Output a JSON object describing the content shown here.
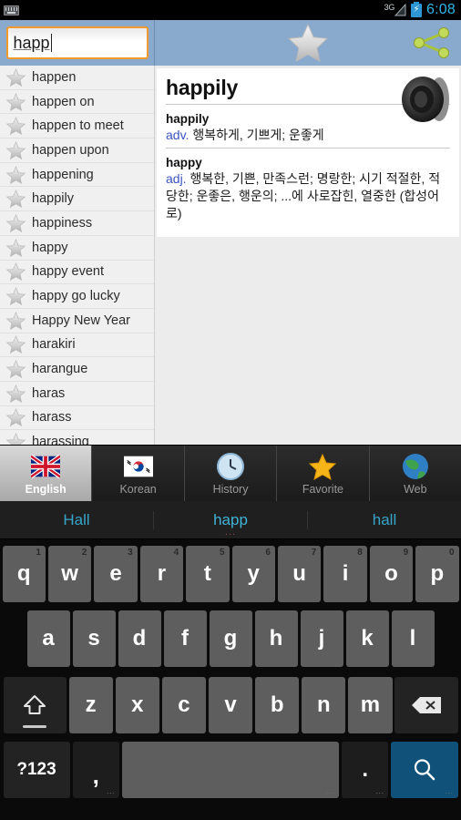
{
  "statusbar": {
    "keyboard_icon": "keyboard-icon",
    "network_label": "3G",
    "battery_icon": "battery-charging-icon",
    "time": "6:08"
  },
  "topbar": {
    "search_value": "happ",
    "search_placeholder": "",
    "favorite_icon": "star-icon",
    "share_icon": "share-icon"
  },
  "wordlist": {
    "items": [
      {
        "label": "happen"
      },
      {
        "label": "happen on"
      },
      {
        "label": "happen to meet"
      },
      {
        "label": "happen upon"
      },
      {
        "label": "happening"
      },
      {
        "label": "happily"
      },
      {
        "label": "happiness"
      },
      {
        "label": "happy"
      },
      {
        "label": "happy event"
      },
      {
        "label": "happy go lucky"
      },
      {
        "label": "Happy New Year"
      },
      {
        "label": "harakiri"
      },
      {
        "label": "harangue"
      },
      {
        "label": "haras"
      },
      {
        "label": "harass"
      },
      {
        "label": "harassing"
      }
    ]
  },
  "definition": {
    "headword": "happily",
    "speaker_icon": "speaker-icon",
    "entries": [
      {
        "word": "happily",
        "pos": "adv.",
        "meaning": "행복하게, 기쁘게; 운좋게"
      },
      {
        "word": "happy",
        "pos": "adj.",
        "meaning": "행복한, 기쁜, 만족스런; 명랑한; 시기 적절한, 적당한; 운좋은, 행운의; ...에 사로잡힌, 열중한 (합성어로)"
      }
    ]
  },
  "tabs": [
    {
      "label": "English",
      "icon": "uk-flag-icon",
      "active": true
    },
    {
      "label": "Korean",
      "icon": "korea-flag-icon",
      "active": false
    },
    {
      "label": "History",
      "icon": "clock-icon",
      "active": false
    },
    {
      "label": "Favorite",
      "icon": "star-icon",
      "active": false
    },
    {
      "label": "Web",
      "icon": "globe-icon",
      "active": false
    }
  ],
  "keyboard": {
    "suggestions": [
      {
        "text": "Hall"
      },
      {
        "text": "happ",
        "dots": "..."
      },
      {
        "text": "hall"
      }
    ],
    "row1": [
      {
        "letter": "q",
        "num": "1"
      },
      {
        "letter": "w",
        "num": "2"
      },
      {
        "letter": "e",
        "num": "3"
      },
      {
        "letter": "r",
        "num": "4"
      },
      {
        "letter": "t",
        "num": "5"
      },
      {
        "letter": "y",
        "num": "6"
      },
      {
        "letter": "u",
        "num": "7"
      },
      {
        "letter": "i",
        "num": "8"
      },
      {
        "letter": "o",
        "num": "9"
      },
      {
        "letter": "p",
        "num": "0"
      }
    ],
    "row2": [
      {
        "letter": "a"
      },
      {
        "letter": "s"
      },
      {
        "letter": "d"
      },
      {
        "letter": "f"
      },
      {
        "letter": "g"
      },
      {
        "letter": "h"
      },
      {
        "letter": "j"
      },
      {
        "letter": "k"
      },
      {
        "letter": "l"
      }
    ],
    "row3": [
      {
        "letter": "z"
      },
      {
        "letter": "x"
      },
      {
        "letter": "c"
      },
      {
        "letter": "v"
      },
      {
        "letter": "b"
      },
      {
        "letter": "n"
      },
      {
        "letter": "m"
      }
    ],
    "shift_icon": "shift-icon",
    "backspace_icon": "backspace-icon",
    "sym_label": "?123",
    "comma_label": ",",
    "space_label": "",
    "period_label": ".",
    "search_icon": "search-icon",
    "minidots": "..."
  },
  "colors": {
    "accent_blue": "#89a9cd",
    "search_border": "#f29a2e",
    "status_time": "#33b5e5",
    "pos_color": "#3b55c4",
    "enter_key": "#0f5179",
    "suggestion_text": "#36a5c9"
  }
}
